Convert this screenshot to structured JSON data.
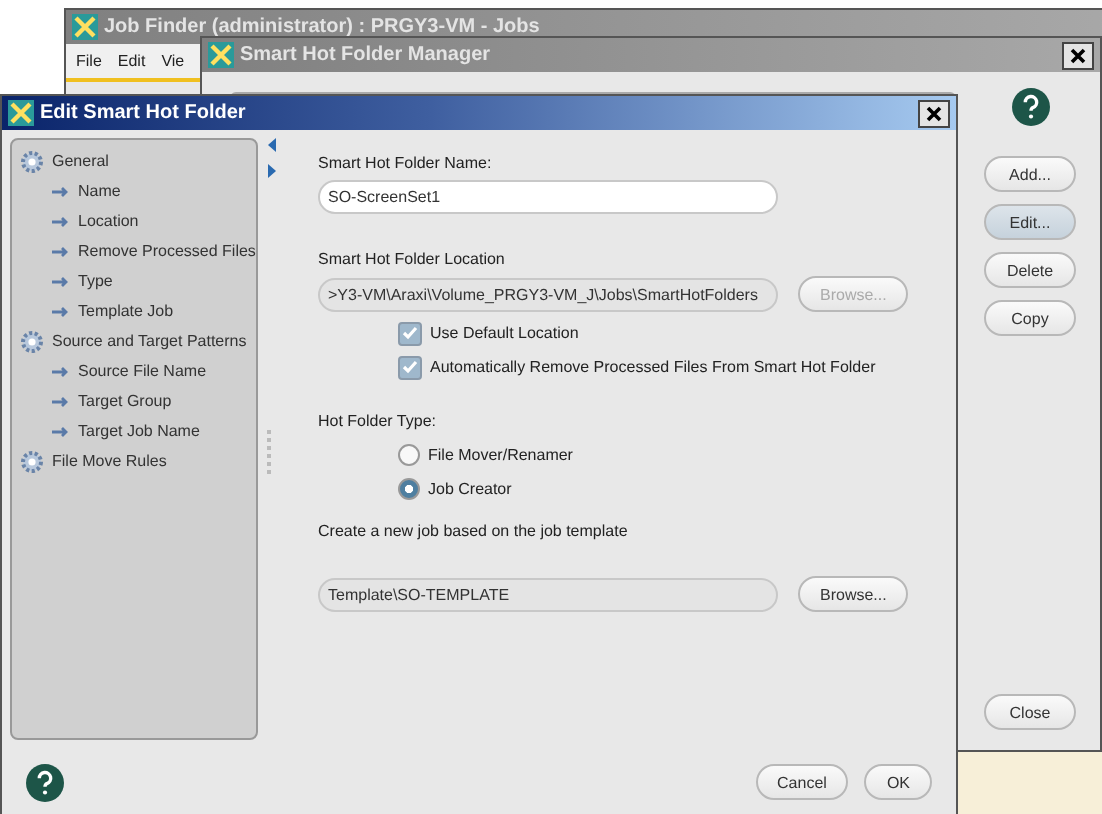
{
  "job_finder": {
    "title": "Job Finder (administrator) : PRGY3-VM - Jobs",
    "menu": [
      "File",
      "Edit",
      "Vie"
    ]
  },
  "manager": {
    "title": "Smart Hot Folder Manager",
    "buttons": [
      {
        "label": "Add...",
        "selected": false
      },
      {
        "label": "Edit...",
        "selected": true
      },
      {
        "label": "Delete",
        "selected": false
      },
      {
        "label": "Copy",
        "selected": false
      }
    ],
    "close_label": "Close"
  },
  "editor": {
    "title": "Edit Smart Hot Folder",
    "nav": [
      {
        "label": "General",
        "children": [
          {
            "label": "Name"
          },
          {
            "label": "Location"
          },
          {
            "label": "Remove Processed Files"
          },
          {
            "label": "Type"
          },
          {
            "label": "Template Job"
          }
        ]
      },
      {
        "label": "Source and Target Patterns",
        "children": [
          {
            "label": "Source File Name"
          },
          {
            "label": "Target Group"
          },
          {
            "label": "Target Job Name"
          }
        ]
      },
      {
        "label": "File Move Rules"
      }
    ],
    "name_field": {
      "label": "Smart Hot Folder Name:",
      "value": "SO-ScreenSet1"
    },
    "location": {
      "label": "Smart Hot Folder Location",
      "value": ">Y3-VM\\Araxi\\Volume_PRGY3-VM_J\\Jobs\\SmartHotFolders",
      "browse": {
        "label": "Browse...",
        "disabled": true
      }
    },
    "checkboxes": [
      {
        "label": "Use Default Location",
        "checked": true
      },
      {
        "label": "Automatically Remove Processed Files From Smart Hot Folder",
        "checked": true
      }
    ],
    "type": {
      "label": "Hot Folder Type:",
      "options": [
        {
          "label": "File Mover/Renamer",
          "selected": false
        },
        {
          "label": "Job Creator",
          "selected": true
        }
      ]
    },
    "template": {
      "label": "Create a new job based on the job template",
      "value": "Template\\SO-TEMPLATE",
      "browse": {
        "label": "Browse...",
        "disabled": false
      }
    },
    "buttons": [
      "Cancel",
      "OK"
    ]
  }
}
